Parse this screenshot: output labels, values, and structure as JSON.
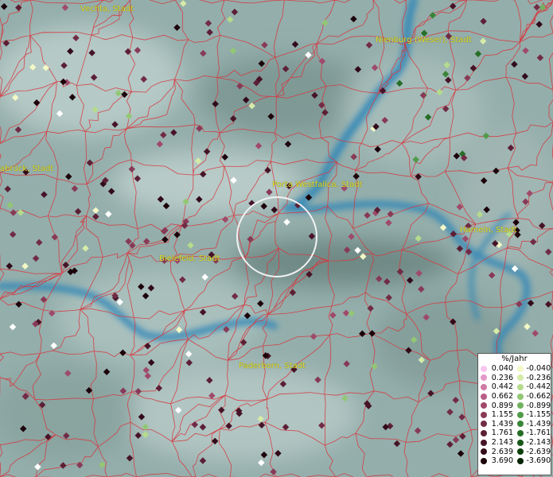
{
  "cities": [
    {
      "name": "Vechta, Stadt"
    },
    {
      "name": "Nienburg (Weser), Stadt"
    },
    {
      "name": "abrück, Stadt"
    },
    {
      "name": "Porta Westfalica, Stadt"
    },
    {
      "name": "Hameln, Stadt"
    },
    {
      "name": "Bielefeld, Stadt"
    },
    {
      "name": "Paderborn, Stadt"
    }
  ],
  "legend": {
    "title": "%/Jahr",
    "positive": [
      {
        "value": "0.040",
        "color": "#f6c6ef"
      },
      {
        "value": "0.236",
        "color": "#e49ac8"
      },
      {
        "value": "0.442",
        "color": "#cf7ba5"
      },
      {
        "value": "0.662",
        "color": "#b85f86"
      },
      {
        "value": "0.899",
        "color": "#9f4a6a"
      },
      {
        "value": "1.155",
        "color": "#873a56"
      },
      {
        "value": "1.439",
        "color": "#712b45"
      },
      {
        "value": "1.761",
        "color": "#5c1f35"
      },
      {
        "value": "2.143",
        "color": "#471427"
      },
      {
        "value": "2.639",
        "color": "#320a19"
      },
      {
        "value": "3.690",
        "color": "#1c020a"
      }
    ],
    "negative": [
      {
        "value": "-0.040",
        "color": "#f2f8c6"
      },
      {
        "value": "-0.236",
        "color": "#d5eba8"
      },
      {
        "value": "-0.442",
        "color": "#b5db8c"
      },
      {
        "value": "-0.662",
        "color": "#93c774"
      },
      {
        "value": "-0.899",
        "color": "#71b25f"
      },
      {
        "value": "-1.155",
        "color": "#519b4a"
      },
      {
        "value": "-1.439",
        "color": "#3a8538"
      },
      {
        "value": "-1.761",
        "color": "#276e27"
      },
      {
        "value": "-2.143",
        "color": "#175717"
      },
      {
        "value": "-2.639",
        "color": "#0b3f0b"
      },
      {
        "value": "-3.690",
        "color": "#032503"
      }
    ]
  }
}
